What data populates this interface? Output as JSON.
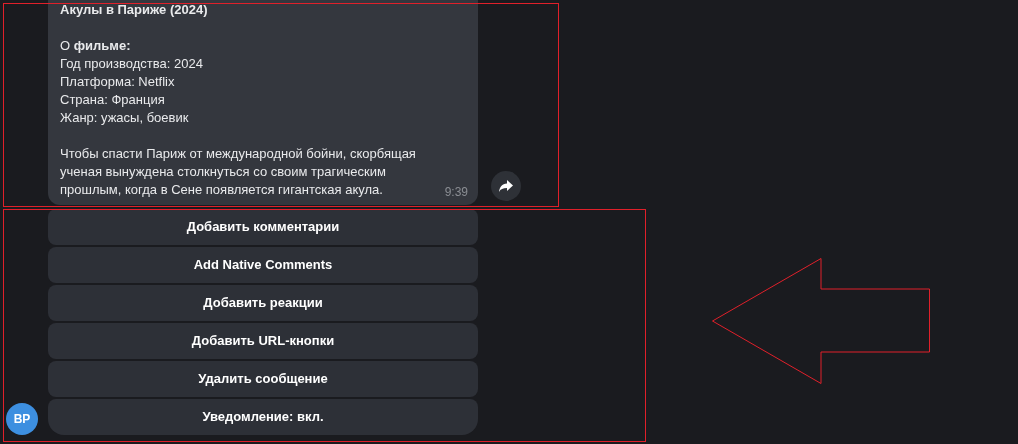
{
  "message": {
    "title": "Акулы в Париже (2024)",
    "details": [
      "О **фильме:**",
      "Год производства: 2024",
      "Платформа: Netflix",
      "Страна: Франция",
      "Жанр: ужасы, боевик"
    ],
    "description": "Чтобы спасти Париж от международной бойни, скорбящая ученая вынуждена столкнуться со своим трагическим прошлым, когда в Сене появляется гигантская акула.",
    "time": "9:39"
  },
  "buttons": [
    "Добавить комментарии",
    "Add Native Comments",
    "Добавить реакции",
    "Добавить URL-кнопки",
    "Удалить сообщение",
    "Уведомление: вкл."
  ],
  "avatar": {
    "initials": "BP"
  }
}
